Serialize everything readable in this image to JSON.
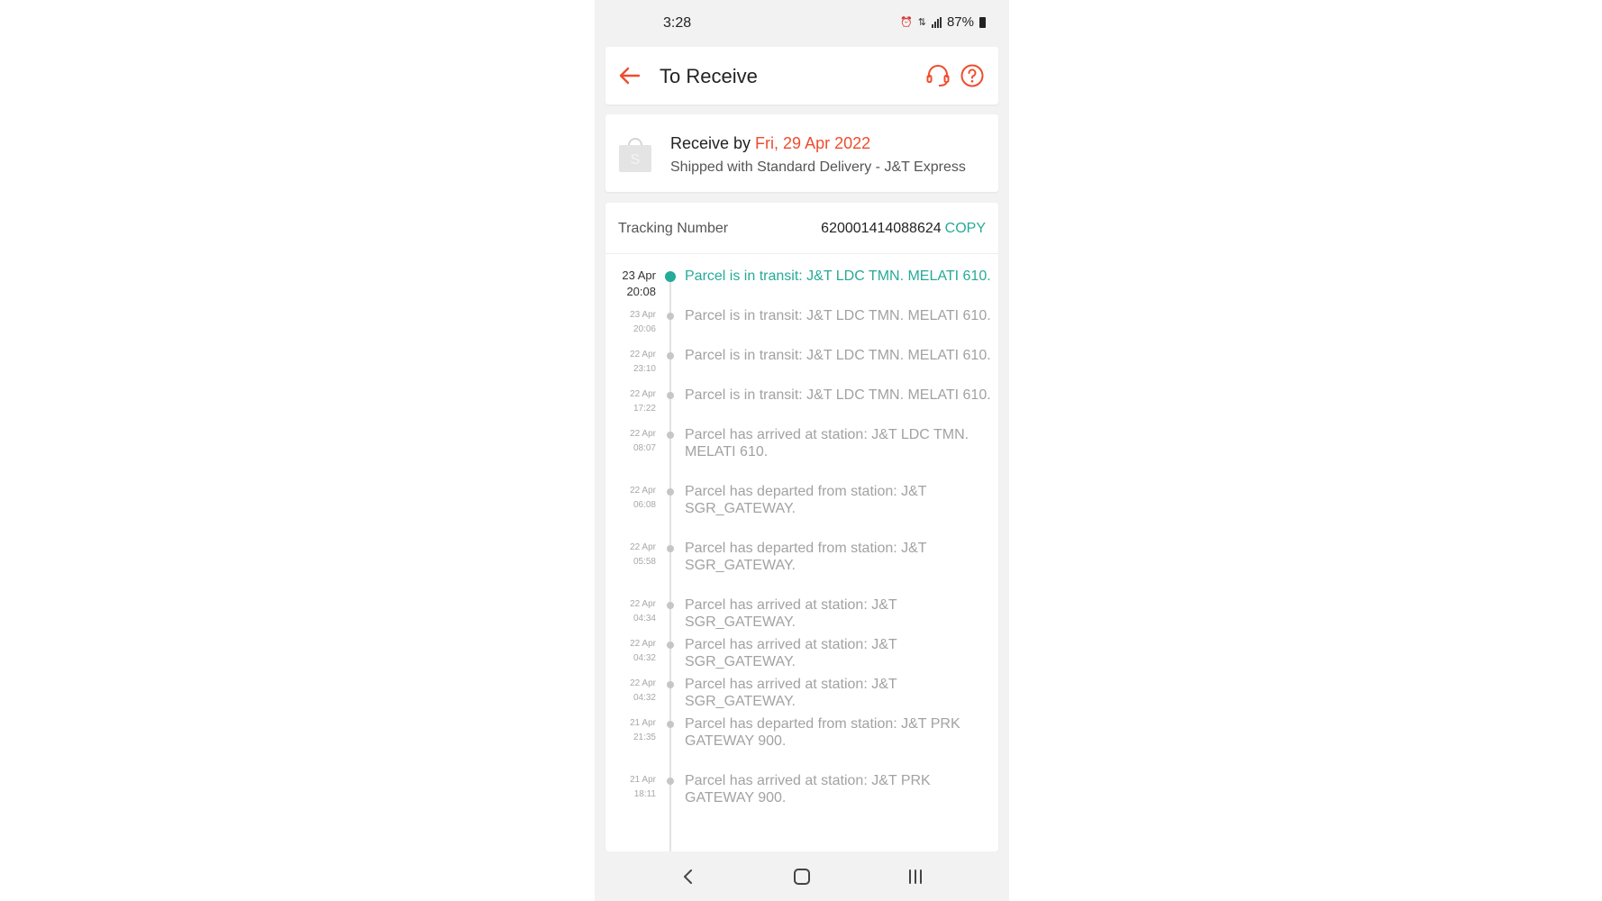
{
  "status_bar": {
    "time": "3:28",
    "battery": "87%"
  },
  "header": {
    "title": "To Receive",
    "back_icon": "arrow-left-icon",
    "chat_icon": "headset-icon",
    "help_icon": "help-circle-icon"
  },
  "delivery": {
    "receive_by_label": "Receive by ",
    "receive_by_date": "Fri, 29 Apr 2022",
    "shipping": "Shipped with Standard Delivery - J&T Express"
  },
  "tracking": {
    "label": "Tracking Number",
    "number": "620001414088624",
    "copy_label": "COPY"
  },
  "events": [
    {
      "date": "23 Apr",
      "time": "20:08",
      "text": "Parcel is in transit: J&T LDC TMN. MELATI 610."
    },
    {
      "date": "23 Apr",
      "time": "20:06",
      "text": "Parcel is in transit: J&T LDC TMN. MELATI 610."
    },
    {
      "date": "22 Apr",
      "time": "23:10",
      "text": "Parcel is in transit: J&T LDC TMN. MELATI 610."
    },
    {
      "date": "22 Apr",
      "time": "17:22",
      "text": "Parcel is in transit: J&T LDC TMN. MELATI 610."
    },
    {
      "date": "22 Apr",
      "time": "08:07",
      "text": "Parcel has arrived at station: J&T LDC TMN. MELATI 610."
    },
    {
      "date": "22 Apr",
      "time": "06:08",
      "text": "Parcel has departed from station: J&T SGR_GATEWAY."
    },
    {
      "date": "22 Apr",
      "time": "05:58",
      "text": "Parcel has departed from station: J&T SGR_GATEWAY."
    },
    {
      "date": "22 Apr",
      "time": "04:34",
      "text": "Parcel has arrived at station: J&T SGR_GATEWAY."
    },
    {
      "date": "22 Apr",
      "time": "04:32",
      "text": "Parcel has arrived at station: J&T SGR_GATEWAY."
    },
    {
      "date": "22 Apr",
      "time": "04:32",
      "text": "Parcel has arrived at station: J&T SGR_GATEWAY."
    },
    {
      "date": "21 Apr",
      "time": "21:35",
      "text": "Parcel has departed from station: J&T PRK GATEWAY 900."
    },
    {
      "date": "21 Apr",
      "time": "18:11",
      "text": "Parcel has arrived at station: J&T PRK GATEWAY 900."
    }
  ],
  "colors": {
    "accent": "#ee4d2d",
    "teal": "#26aa99"
  }
}
